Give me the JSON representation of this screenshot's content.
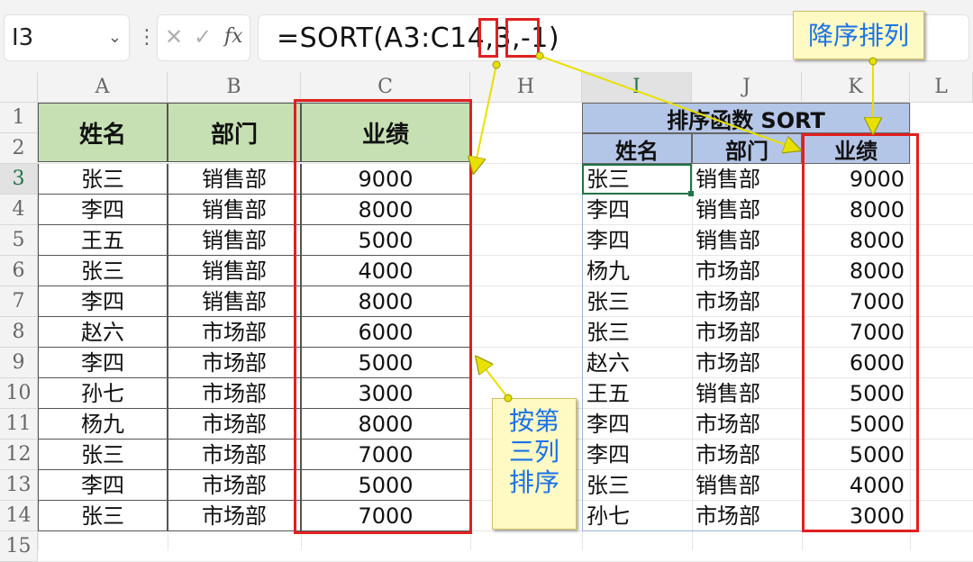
{
  "formula_bar": {
    "name_box": "I3",
    "dropdown_glyph": "⌄",
    "kebab_glyph": "⋮",
    "cancel_glyph": "✕",
    "confirm_glyph": "✓",
    "fx_label": "fx",
    "formula": "=SORT(A3:C14,3,-1)"
  },
  "columns": [
    "A",
    "B",
    "C",
    "H",
    "I",
    "J",
    "K",
    "L"
  ],
  "rows": [
    "1",
    "2",
    "3",
    "4",
    "5",
    "6",
    "7",
    "8",
    "9",
    "10",
    "11",
    "12",
    "13",
    "14",
    "15"
  ],
  "source_table": {
    "headers": [
      "姓名",
      "部门",
      "业绩"
    ],
    "rows": [
      [
        "张三",
        "销售部",
        "9000"
      ],
      [
        "李四",
        "销售部",
        "8000"
      ],
      [
        "王五",
        "销售部",
        "5000"
      ],
      [
        "张三",
        "销售部",
        "4000"
      ],
      [
        "李四",
        "销售部",
        "8000"
      ],
      [
        "赵六",
        "市场部",
        "6000"
      ],
      [
        "李四",
        "市场部",
        "5000"
      ],
      [
        "孙七",
        "市场部",
        "3000"
      ],
      [
        "杨九",
        "市场部",
        "8000"
      ],
      [
        "张三",
        "市场部",
        "7000"
      ],
      [
        "李四",
        "市场部",
        "5000"
      ],
      [
        "张三",
        "市场部",
        "7000"
      ]
    ]
  },
  "sorted_table": {
    "title": "排序函数 SORT",
    "headers": [
      "姓名",
      "部门",
      "业绩"
    ],
    "rows": [
      [
        "张三",
        "销售部",
        "9000"
      ],
      [
        "李四",
        "销售部",
        "8000"
      ],
      [
        "李四",
        "销售部",
        "8000"
      ],
      [
        "杨九",
        "市场部",
        "8000"
      ],
      [
        "张三",
        "市场部",
        "7000"
      ],
      [
        "张三",
        "市场部",
        "7000"
      ],
      [
        "赵六",
        "市场部",
        "6000"
      ],
      [
        "王五",
        "销售部",
        "5000"
      ],
      [
        "李四",
        "市场部",
        "5000"
      ],
      [
        "李四",
        "市场部",
        "5000"
      ],
      [
        "张三",
        "销售部",
        "4000"
      ],
      [
        "孙七",
        "市场部",
        "3000"
      ]
    ]
  },
  "annotations": {
    "sort_desc": "降序排列",
    "sort_by_col3": [
      "按第",
      "三列",
      "排序"
    ]
  },
  "colors": {
    "header_green": "#c6e0b4",
    "header_blue": "#b4c6e7",
    "highlight_red": "#e02020",
    "callout_bg": "#fff9c4",
    "callout_text": "#1a73e8",
    "arrow": "#e8e000"
  }
}
